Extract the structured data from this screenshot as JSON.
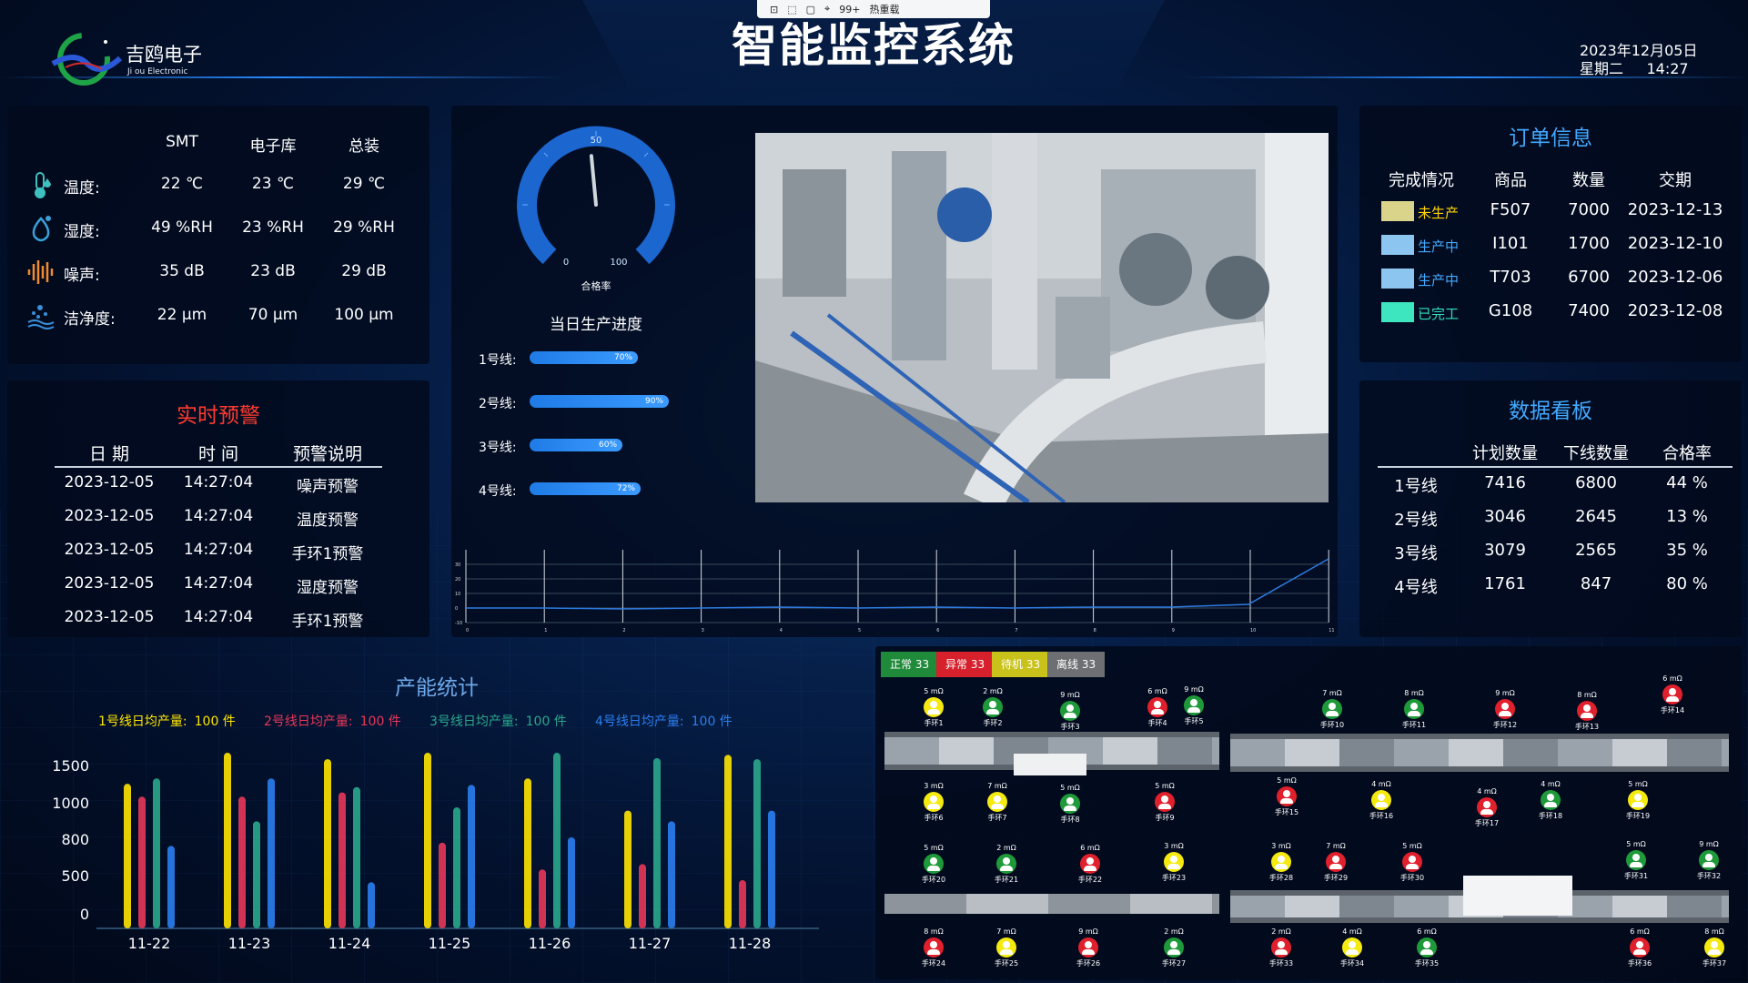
{
  "toolbar": {
    "badge": "99+",
    "hot": "热重载"
  },
  "header": {
    "title": "智能监控系统",
    "brand": "吉鸥电子",
    "brand_sub": "Ji ou Electronic",
    "date": "2023年12月05日",
    "weekday": "星期二",
    "time": "14:27"
  },
  "env": {
    "columns": [
      "SMT",
      "电子库",
      "总装"
    ],
    "rows": [
      {
        "label": "温度:",
        "values": [
          "22 ℃",
          "23 ℃",
          "29 ℃"
        ]
      },
      {
        "label": "湿度:",
        "values": [
          "49 %RH",
          "23 %RH",
          "29 %RH"
        ]
      },
      {
        "label": "噪声:",
        "values": [
          "35 dB",
          "23 dB",
          "29 dB"
        ]
      },
      {
        "label": "洁净度:",
        "values": [
          "22 μm",
          "70 μm",
          "100 μm"
        ]
      }
    ]
  },
  "alerts": {
    "title": "实时预警",
    "columns": [
      "日 期",
      "时 间",
      "预警说明"
    ],
    "rows": [
      [
        "2023-12-05",
        "14:27:04",
        "噪声预警"
      ],
      [
        "2023-12-05",
        "14:27:04",
        "温度预警"
      ],
      [
        "2023-12-05",
        "14:27:04",
        "手环1预警"
      ],
      [
        "2023-12-05",
        "14:27:04",
        "湿度预警"
      ],
      [
        "2023-12-05",
        "14:27:04",
        "手环1预警"
      ]
    ]
  },
  "gauge": {
    "min_label": "0",
    "max_label": "100",
    "mid_label": "50",
    "caption": "合格率",
    "value": 48
  },
  "progress": {
    "title": "当日生产进度",
    "lines": [
      {
        "label": "1号线:",
        "pct": 70,
        "pct_label": "70%"
      },
      {
        "label": "2号线:",
        "pct": 90,
        "pct_label": "90%"
      },
      {
        "label": "3号线:",
        "pct": 60,
        "pct_label": "60%"
      },
      {
        "label": "4号线:",
        "pct": 72,
        "pct_label": "72%"
      }
    ]
  },
  "trend": {
    "y_ticks": [
      "30",
      "20",
      "10",
      "0",
      "-10"
    ],
    "x_ticks": [
      "0",
      "1",
      "2",
      "3",
      "4",
      "5",
      "6",
      "7",
      "8",
      "9",
      "10",
      "11"
    ]
  },
  "orders": {
    "title": "订单信息",
    "columns": [
      "完成情况",
      "商品",
      "数量",
      "交期"
    ],
    "rows": [
      {
        "status": "未生产",
        "swatch": "#d9d48a",
        "status_color": "#ffd400",
        "product": "F507",
        "qty": "7000",
        "due": "2023-12-13"
      },
      {
        "status": "生产中",
        "swatch": "#8cc6f0",
        "status_color": "#43a9ff",
        "product": "I101",
        "qty": "1700",
        "due": "2023-12-10"
      },
      {
        "status": "生产中",
        "swatch": "#8cc6f0",
        "status_color": "#43a9ff",
        "product": "T703",
        "qty": "6700",
        "due": "2023-12-06"
      },
      {
        "status": "已完工",
        "swatch": "#3ee6bf",
        "status_color": "#30e0c0",
        "product": "G108",
        "qty": "7400",
        "due": "2023-12-08"
      }
    ]
  },
  "board": {
    "title": "数据看板",
    "columns": [
      "计划数量",
      "下线数量",
      "合格率"
    ],
    "rows": [
      [
        "1号线",
        "7416",
        "6800",
        "44 %"
      ],
      [
        "2号线",
        "3046",
        "2645",
        "13 %"
      ],
      [
        "3号线",
        "3079",
        "2565",
        "35 %"
      ],
      [
        "4号线",
        "1761",
        "847",
        "80 %"
      ]
    ]
  },
  "capacity": {
    "title": "产能统计",
    "legend": [
      {
        "label": "1号线日均产量:",
        "value": "100 件",
        "color": "#ffe600"
      },
      {
        "label": "2号线日均产量:",
        "value": "100 件",
        "color": "#e8375a"
      },
      {
        "label": "3号线日均产量:",
        "value": "100 件",
        "color": "#2aa88c"
      },
      {
        "label": "4号线日均产量:",
        "value": "100 件",
        "color": "#2a7ef0"
      }
    ]
  },
  "chart_data": {
    "type": "bar",
    "title": "产能统计",
    "categories": [
      "11-22",
      "11-23",
      "11-24",
      "11-25",
      "11-26",
      "11-27",
      "11-28"
    ],
    "y_ticks": [
      "1500",
      "1000",
      "800",
      "500",
      "0"
    ],
    "series": [
      {
        "name": "1号线",
        "color": "#ffe600",
        "values": [
          1350,
          1640,
          1580,
          1640,
          1400,
          1100,
          1620
        ]
      },
      {
        "name": "2号线",
        "color": "#e8375a",
        "values": [
          1230,
          1230,
          1270,
          800,
          550,
          600,
          450
        ]
      },
      {
        "name": "3号线",
        "color": "#2aa88c",
        "values": [
          1400,
          1000,
          1320,
          1130,
          1640,
          1590,
          1580
        ]
      },
      {
        "name": "4号线",
        "color": "#2a7ef0",
        "values": [
          770,
          1400,
          430,
          1340,
          850,
          1000,
          1100
        ]
      }
    ]
  },
  "stations": {
    "legend": [
      {
        "label": "正常 33",
        "color": "#1f8a3a"
      },
      {
        "label": "异常 33",
        "color": "#d6202c"
      },
      {
        "label": "待机 33",
        "color": "#c9c21a"
      },
      {
        "label": "离线 33",
        "color": "#6d6f72"
      }
    ],
    "items": [
      {
        "r": "5 mΩ",
        "n": "手环1",
        "s": "y"
      },
      {
        "r": "2 mΩ",
        "n": "手环2",
        "s": "g"
      },
      {
        "r": "9 mΩ",
        "n": "手环3",
        "s": "g"
      },
      {
        "r": "6 mΩ",
        "n": "手环4",
        "s": "r"
      },
      {
        "r": "9 mΩ",
        "n": "手环5",
        "s": "g"
      },
      {
        "r": "3 mΩ",
        "n": "手环6",
        "s": "y"
      },
      {
        "r": "7 mΩ",
        "n": "手环7",
        "s": "y"
      },
      {
        "r": "5 mΩ",
        "n": "手环8",
        "s": "g"
      },
      {
        "r": "5 mΩ",
        "n": "手环9",
        "s": "r"
      },
      {
        "r": "7 mΩ",
        "n": "手环10",
        "s": "g"
      },
      {
        "r": "8 mΩ",
        "n": "手环11",
        "s": "g"
      },
      {
        "r": "9 mΩ",
        "n": "手环12",
        "s": "r"
      },
      {
        "r": "8 mΩ",
        "n": "手环13",
        "s": "r"
      },
      {
        "r": "6 mΩ",
        "n": "手环14",
        "s": "r"
      },
      {
        "r": "5 mΩ",
        "n": "手环15",
        "s": "r"
      },
      {
        "r": "4 mΩ",
        "n": "手环16",
        "s": "y"
      },
      {
        "r": "4 mΩ",
        "n": "手环17",
        "s": "r"
      },
      {
        "r": "4 mΩ",
        "n": "手环18",
        "s": "g"
      },
      {
        "r": "5 mΩ",
        "n": "手环19",
        "s": "y"
      },
      {
        "r": "5 mΩ",
        "n": "手环20",
        "s": "g"
      },
      {
        "r": "2 mΩ",
        "n": "手环21",
        "s": "g"
      },
      {
        "r": "6 mΩ",
        "n": "手环22",
        "s": "r"
      },
      {
        "r": "3 mΩ",
        "n": "手环23",
        "s": "y"
      },
      {
        "r": "3 mΩ",
        "n": "手环28",
        "s": "y"
      },
      {
        "r": "7 mΩ",
        "n": "手环29",
        "s": "r"
      },
      {
        "r": "5 mΩ",
        "n": "手环30",
        "s": "r"
      },
      {
        "r": "5 mΩ",
        "n": "手环31",
        "s": "g"
      },
      {
        "r": "9 mΩ",
        "n": "手环32",
        "s": "g"
      },
      {
        "r": "8 mΩ",
        "n": "手环24",
        "s": "r"
      },
      {
        "r": "7 mΩ",
        "n": "手环25",
        "s": "y"
      },
      {
        "r": "9 mΩ",
        "n": "手环26",
        "s": "r"
      },
      {
        "r": "2 mΩ",
        "n": "手环27",
        "s": "g"
      },
      {
        "r": "2 mΩ",
        "n": "手环33",
        "s": "r"
      },
      {
        "r": "4 mΩ",
        "n": "手环34",
        "s": "y"
      },
      {
        "r": "6 mΩ",
        "n": "手环35",
        "s": "g"
      },
      {
        "r": "6 mΩ",
        "n": "手环36",
        "s": "r"
      },
      {
        "r": "8 mΩ",
        "n": "手环37",
        "s": "y"
      }
    ]
  }
}
